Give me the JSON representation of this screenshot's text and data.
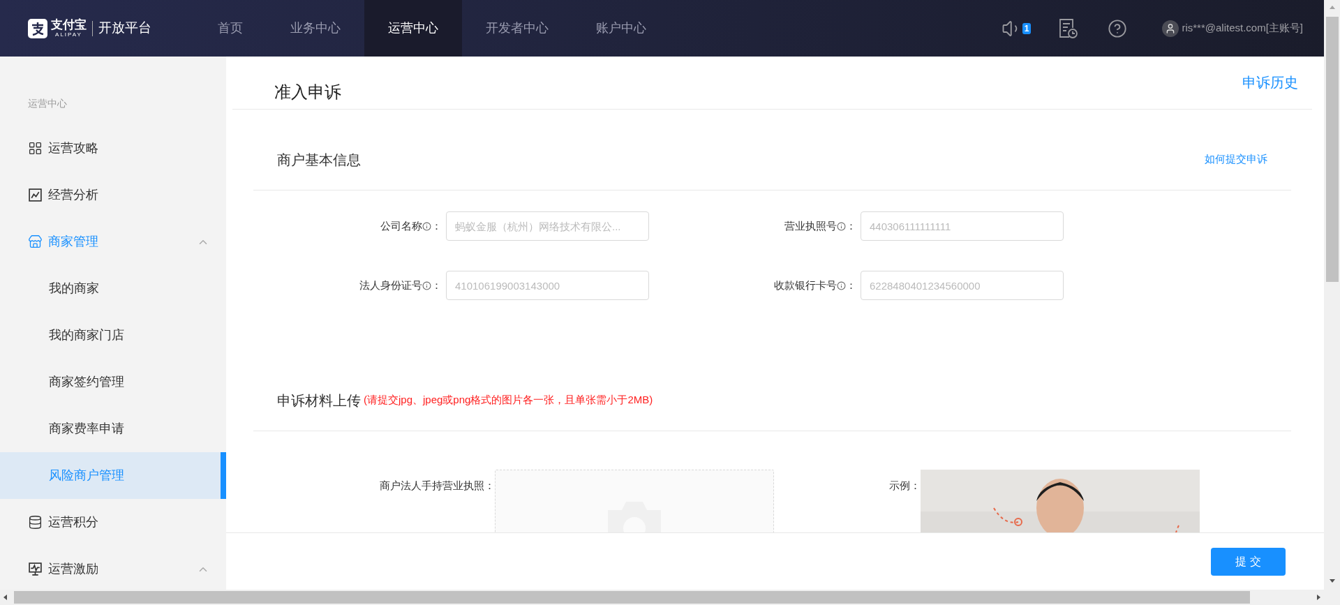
{
  "header": {
    "logo_name": "支付宝",
    "logo_sub": "ALIPAY",
    "platform": "开放平台",
    "nav": [
      {
        "label": "首页",
        "selected": false
      },
      {
        "label": "业务中心",
        "selected": false
      },
      {
        "label": "运营中心",
        "selected": true
      },
      {
        "label": "开发者中心",
        "selected": false
      },
      {
        "label": "账户中心",
        "selected": false
      }
    ],
    "notification_count": "1",
    "user": "ris***@alitest.com[主账号]"
  },
  "sidebar": {
    "title": "运营中心",
    "items": [
      {
        "kind": "link",
        "label": "运营攻略"
      },
      {
        "kind": "link",
        "label": "经营分析"
      },
      {
        "kind": "group",
        "label": "商家管理",
        "expanded": true,
        "children": [
          {
            "label": "我的商家",
            "selected": false
          },
          {
            "label": "我的商家门店",
            "selected": false
          },
          {
            "label": "商家签约管理",
            "selected": false
          },
          {
            "label": "商家费率申请",
            "selected": false
          },
          {
            "label": "风险商户管理",
            "selected": true
          }
        ]
      },
      {
        "kind": "link",
        "label": "运营积分"
      },
      {
        "kind": "group",
        "label": "运营激励",
        "expanded": true
      }
    ]
  },
  "page": {
    "title": "准入申诉",
    "history_link": "申诉历史",
    "basic": {
      "title": "商户基本信息",
      "help_link": "如何提交申诉",
      "fields": [
        {
          "label": "公司名称",
          "suffix": "：",
          "placeholder": "蚂蚁金服（杭州）网络技术有限公..."
        },
        {
          "label": "营业执照号",
          "suffix": "：",
          "placeholder": "440306111111111"
        },
        {
          "label": "法人身份证号",
          "suffix": "：",
          "placeholder": "410106199003143000"
        },
        {
          "label": "收款银行卡号",
          "suffix": "：",
          "placeholder": "6228480401234560000"
        }
      ]
    },
    "upload": {
      "title": "申诉材料上传",
      "note": "(请提交jpg、jpeg或png格式的图片各一张，且单张需小于2MB)",
      "items": [
        {
          "label": "商户法人手持营业执照：",
          "example_label": "示例："
        }
      ]
    }
  },
  "footer": {
    "submit": "提 交"
  }
}
